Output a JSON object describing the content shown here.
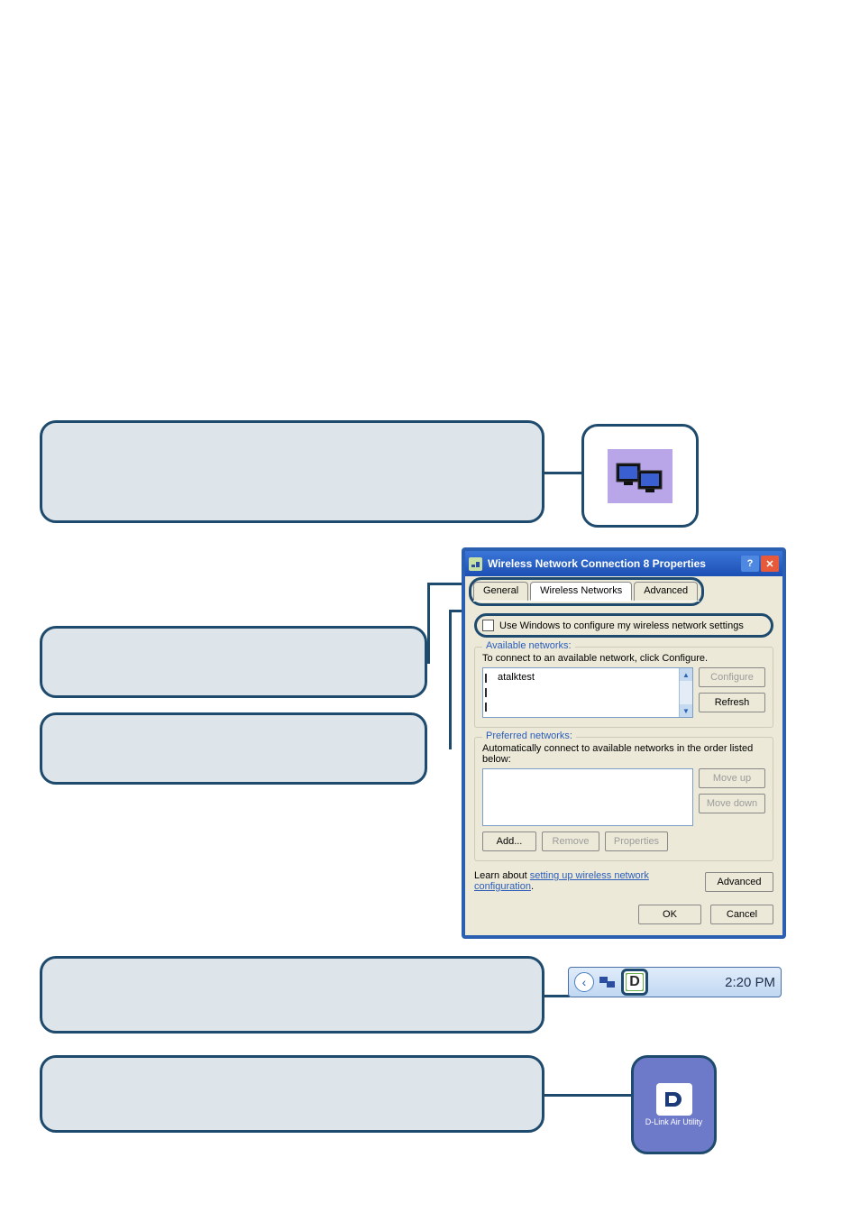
{
  "taskbar": {
    "time": "2:20 PM"
  },
  "icon_labels": {
    "dlink_utility": "D-Link Air Utility"
  },
  "dialog": {
    "title": "Wireless Network Connection 8 Properties",
    "tabs": {
      "general": "General",
      "wireless": "Wireless Networks",
      "advanced": "Advanced"
    },
    "use_windows_label": "Use Windows to configure my wireless network settings",
    "available": {
      "legend": "Available networks:",
      "hint": "To connect to an available network, click Configure.",
      "items": [
        "atalktest",
        "",
        ""
      ],
      "configure": "Configure",
      "refresh": "Refresh"
    },
    "preferred": {
      "legend": "Preferred networks:",
      "hint": "Automatically connect to available networks in the order listed below:",
      "move_up": "Move up",
      "move_down": "Move down",
      "add": "Add...",
      "remove": "Remove",
      "properties": "Properties"
    },
    "learn": {
      "prefix": "Learn about ",
      "link": "setting up wireless network configuration",
      "suffix": "."
    },
    "advanced_btn": "Advanced",
    "ok": "OK",
    "cancel": "Cancel"
  }
}
